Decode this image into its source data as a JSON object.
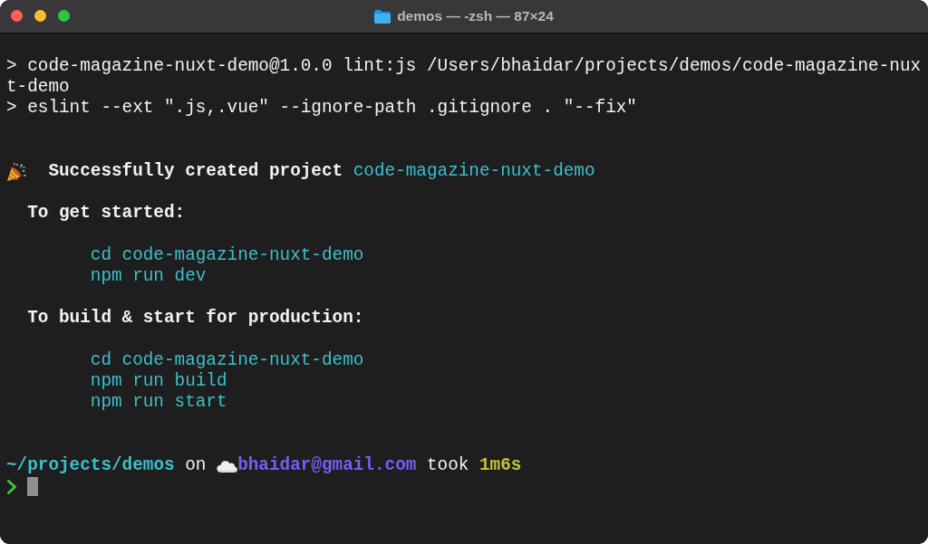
{
  "window": {
    "title": "demos — -zsh — 87×24"
  },
  "terminal": {
    "lines": [
      {
        "kind": "command",
        "text": "> code-magazine-nuxt-demo@1.0.0 lint:js /Users/bhaidar/projects/demos/code-magazine-nuxt-demo"
      },
      {
        "kind": "command",
        "text": "> eslint --ext \".js,.vue\" --ignore-path .gitignore . \"--fix\""
      },
      {
        "kind": "blank"
      },
      {
        "kind": "blank"
      },
      {
        "kind": "success",
        "message": "Successfully created project",
        "project": "code-magazine-nuxt-demo"
      },
      {
        "kind": "blank"
      },
      {
        "kind": "heading",
        "text": "To get started:"
      },
      {
        "kind": "blank"
      },
      {
        "kind": "code",
        "text": "cd code-magazine-nuxt-demo"
      },
      {
        "kind": "code",
        "text": "npm run dev"
      },
      {
        "kind": "blank"
      },
      {
        "kind": "heading",
        "text": "To build & start for production:"
      },
      {
        "kind": "blank"
      },
      {
        "kind": "code",
        "text": "cd code-magazine-nuxt-demo"
      },
      {
        "kind": "code",
        "text": "npm run build"
      },
      {
        "kind": "code",
        "text": "npm run start"
      },
      {
        "kind": "blank"
      },
      {
        "kind": "blank"
      },
      {
        "kind": "prompt",
        "path": "~/projects/demos",
        "on": "on",
        "account": "bhaidar@gmail.com",
        "took": "took",
        "duration": "1m6s"
      },
      {
        "kind": "input"
      }
    ]
  }
}
